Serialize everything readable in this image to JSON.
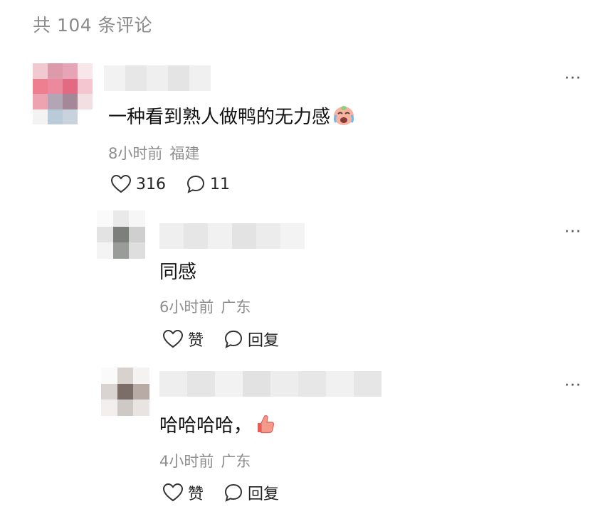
{
  "header": {
    "count_label": "共 104 条评论"
  },
  "more_label": "···",
  "comments": [
    {
      "text": "一种看到熟人做鸭的无力感",
      "emoji": "crying-face-emoji",
      "time": "8小时前",
      "location": "福建",
      "like_count": "316",
      "reply_count": "11"
    }
  ],
  "replies": [
    {
      "text": "同感",
      "time": "6小时前",
      "location": "广东",
      "like_label": "赞",
      "reply_label": "回复"
    },
    {
      "text": "哈哈哈哈，",
      "emoji": "thumbs-up-emoji",
      "time": "4小时前",
      "location": "广东",
      "like_label": "赞",
      "reply_label": "回复"
    }
  ],
  "colors": {
    "meta_gray": "#8e8e8e",
    "header_gray": "#8a8a8a",
    "avatar_main": [
      "#f0c9d1",
      "#dd9aaa",
      "#e6a4b6",
      "#f7e6ea",
      "#ee7f91",
      "#ea8a9c",
      "#e26b83",
      "#f4c6cf",
      "#eea3b1",
      "#b3a6b4",
      "#a58897",
      "#f2dfe3",
      "#f3f3f3",
      "#b9cbd9",
      "#c8d3de",
      "#ffffff"
    ],
    "avatar_reply1": [
      "#fafafa",
      "#e9e9e9",
      "#f6f6f6",
      "#e3e3e3",
      "#7c7f7c",
      "#cfcfcf",
      "#f4f4f4",
      "#999c98",
      "#dedede"
    ],
    "avatar_reply2": [
      "#fafafa",
      "#d8d2cf",
      "#f5f3f2",
      "#d9d4d1",
      "#7b6d68",
      "#b8aaa5",
      "#f2efee",
      "#cfc9c6",
      "#e8e4e2"
    ]
  }
}
